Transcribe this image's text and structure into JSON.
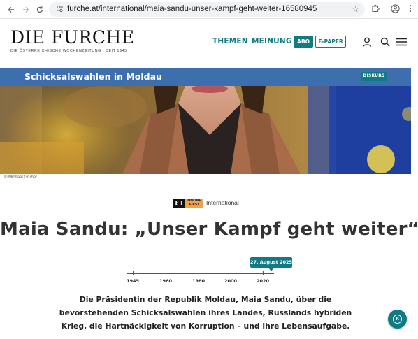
{
  "browser": {
    "url": "furche.at/international/maia-sandu-unser-kampf-geht-weiter-16580945",
    "back_icon": "arrow-left-icon",
    "forward_icon": "arrow-right-icon",
    "reload_icon": "reload-icon",
    "site_info_icon": "tune-icon",
    "bookmark_icon": "star-icon",
    "extensions_icon": "puzzle-icon",
    "profile_icon": "account-icon",
    "menu_icon": "kebab-icon"
  },
  "header": {
    "logo": "DIE FURCHE",
    "tagline": "DIE ÖSTERREICHISCHE WOCHENZEITUNG · SEIT 1945",
    "nav": [
      "THEMEN",
      "MEINUNG"
    ],
    "abo_label": "ABO",
    "epaper_label": "E-PAPER",
    "accent_color": "#0f7b84"
  },
  "topic": {
    "title": "Schicksalswahlen in Moldau",
    "badge": "DISKURS",
    "bar_color": "#3d6fae"
  },
  "hero": {
    "caption": "© Michael Gruber"
  },
  "article": {
    "badge_logo": "F+",
    "badge_text": "ONLINE FIRST",
    "section": "International",
    "headline": "Maia Sandu: „Unser Kampf geht weiter“",
    "lead": "Die Präsidentin der Republik Moldau, Maia Sandu, über die bevorstehenden Schicksalswahlen ihres Landes, Russlands hybriden Krieg, die Hartnäckigkeit von Korruption – und ihre Lebensaufgabe."
  },
  "timeline": {
    "date": "27. August 2025",
    "years": [
      "1945",
      "1960",
      "1980",
      "2000",
      "2020"
    ]
  }
}
